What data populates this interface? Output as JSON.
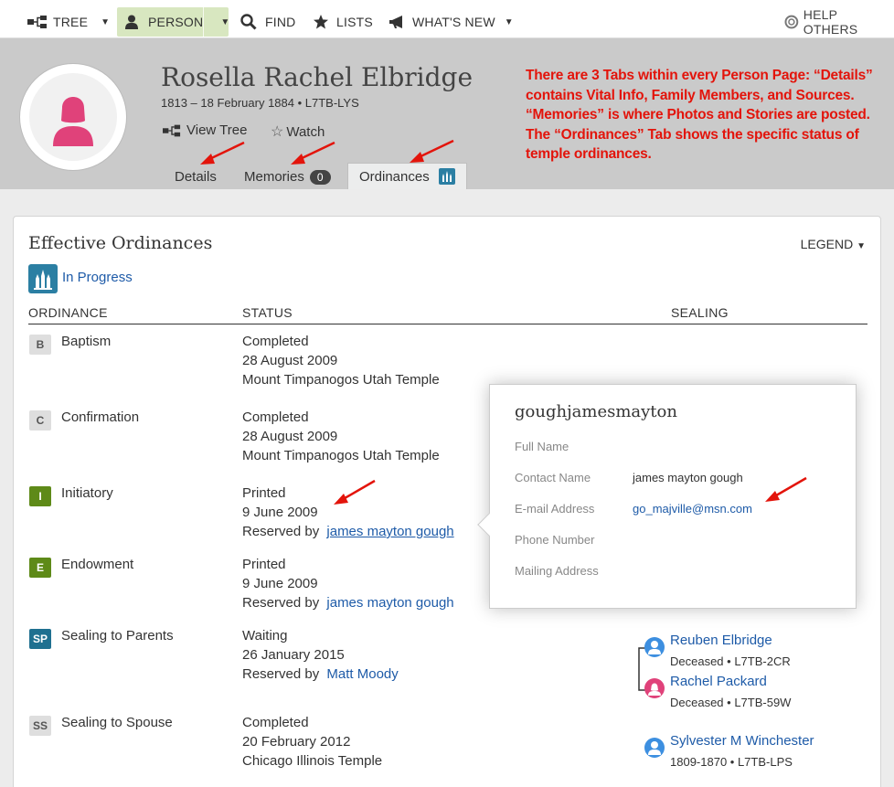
{
  "nav": {
    "tree": "TREE",
    "person": "PERSON",
    "find": "FIND",
    "lists": "LISTS",
    "whats_new": "WHAT'S NEW",
    "help_others": "HELP OTHERS"
  },
  "person": {
    "name": "Rosella Rachel Elbridge",
    "summary": "1813 – 18 February 1884 • L7TB-LYS",
    "view_tree": "View Tree",
    "watch": "Watch",
    "avatar_color": "#e0427a"
  },
  "tabs": {
    "details": "Details",
    "memories": "Memories",
    "memories_count": "0",
    "ordinances": "Ordinances"
  },
  "annotation": "There are 3 Tabs within every Person Page: “Details” contains Vital Info, Family Members, and Sources. “Memories” is where Photos and Stories are posted. The “Ordinances” Tab shows the specific status of temple ordinances.",
  "card": {
    "title": "Effective Ordinances",
    "legend": "LEGEND",
    "in_progress": "In Progress",
    "col_ordinance": "ORDINANCE",
    "col_status": "STATUS",
    "col_sealing": "SEALING"
  },
  "ordinances": [
    {
      "code": "B",
      "name": "Baptism",
      "l1": "Completed",
      "l2": "28 August 2009",
      "l3": "Mount Timpanogos Utah Temple"
    },
    {
      "code": "C",
      "name": "Confirmation",
      "l1": "Completed",
      "l2": "28 August 2009",
      "l3": "Mount Timpanogos Utah Temple"
    },
    {
      "code": "I",
      "name": "Initiatory",
      "l1": "Printed",
      "l2": "9 June 2009",
      "l3_prefix": "Reserved by",
      "l3_link": "james mayton gough"
    },
    {
      "code": "E",
      "name": "Endowment",
      "l1": "Printed",
      "l2": "9 June 2009",
      "l3_prefix": "Reserved by",
      "l3_link": "james mayton gough"
    },
    {
      "code": "SP",
      "name": "Sealing to Parents",
      "l1": "Waiting",
      "l2": "26 January 2015",
      "l3_prefix": "Reserved by",
      "l3_link": "Matt Moody"
    },
    {
      "code": "SS",
      "name": "Sealing to Spouse",
      "l1": "Completed",
      "l2": "20 February 2012",
      "l3": "Chicago Illinois Temple"
    }
  ],
  "popup": {
    "username": "goughjamesmayton",
    "full_name_label": "Full Name",
    "contact_name_label": "Contact Name",
    "contact_name": "james mayton gough",
    "email_label": "E-mail Address",
    "email": "go_majville@msn.com",
    "phone_label": "Phone Number",
    "mailing_label": "Mailing Address"
  },
  "sealing": {
    "father_name": "Reuben Elbridge",
    "father_sub": "Deceased • L7TB-2CR",
    "mother_name": "Rachel Packard",
    "mother_sub": "Deceased • L7TB-59W",
    "spouse_name": "Sylvester M Winchester",
    "spouse_sub": "1809-1870 • L7TB-LPS"
  },
  "colors": {
    "annotation_red": "#e3140b",
    "link_blue": "#1e5ba8",
    "male_blue": "#3d8fe0",
    "female_pink": "#e0427a",
    "temple_teal": "#2b7fa3"
  }
}
